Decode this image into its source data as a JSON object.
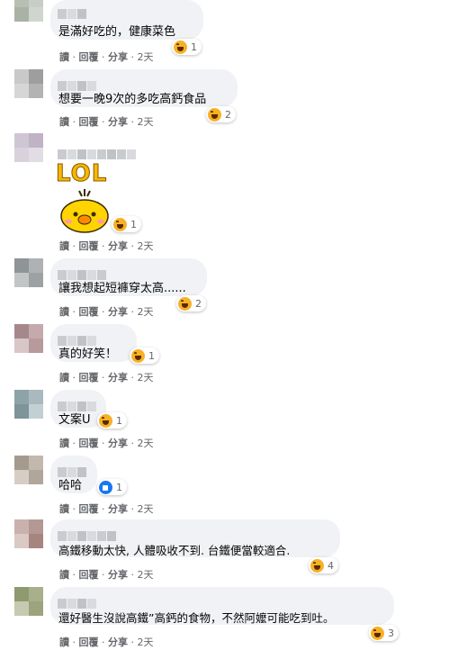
{
  "actions": {
    "read": "讀",
    "reply": "回覆",
    "share": "分享",
    "sep": "·"
  },
  "comments": [
    {
      "text": "是滿好吃的，健康菜色",
      "reaction": "haha",
      "count": "1",
      "time": "2天"
    },
    {
      "text": "想要一晚9次的多吃高鈣食品",
      "reaction": "haha",
      "count": "2",
      "time": "2天"
    },
    {
      "text": "",
      "sticker_text": "LOL",
      "reaction": "haha",
      "count": "1",
      "time": "2天"
    },
    {
      "text": "讓我想起短褲穿太高......",
      "reaction": "haha",
      "count": "2",
      "time": "2天"
    },
    {
      "text": "真的好笑！",
      "reaction": "haha",
      "count": "1",
      "time": "2天"
    },
    {
      "text": "文案U",
      "reaction": "haha",
      "count": "1",
      "time": "2天"
    },
    {
      "text": "哈哈",
      "reaction": "like",
      "count": "1",
      "time": "2天"
    },
    {
      "text": "高鐵移動太快, 人體吸收不到. 台鐵便當較適合.",
      "reaction": "haha",
      "count": "4",
      "time": "2天"
    },
    {
      "text": "還好醫生沒說高鐵”高鈣的食物，不然阿嬤可能吃到吐。",
      "reaction": "haha",
      "count": "3",
      "time": "2天"
    }
  ],
  "colors": {
    "bubble": "#f0f2f5",
    "meta": "#65676b",
    "haha": "#f7b125",
    "like": "#1877f2",
    "sticker_text": "#f5b800"
  }
}
